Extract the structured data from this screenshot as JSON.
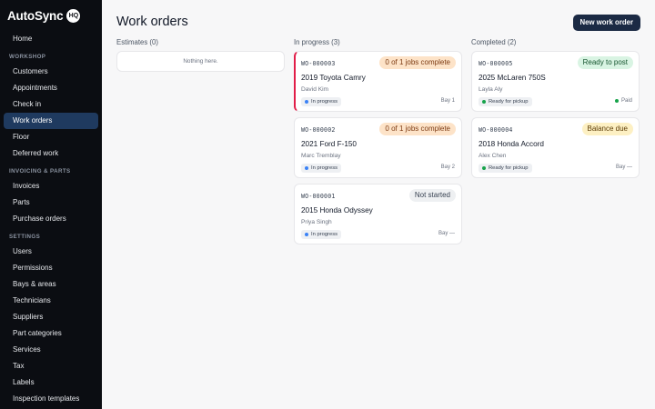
{
  "brand": {
    "name": "AutoSync",
    "badge": "HQ"
  },
  "sidebar": {
    "home": "Home",
    "workshop_title": "WORKSHOP",
    "workshop": [
      "Customers",
      "Appointments",
      "Check in",
      "Work orders",
      "Floor",
      "Deferred work"
    ],
    "invoicing_title": "INVOICING & PARTS",
    "invoicing": [
      "Invoices",
      "Parts",
      "Purchase orders"
    ],
    "settings_title": "SETTINGS",
    "settings": [
      "Users",
      "Permissions",
      "Bays & areas",
      "Technicians",
      "Suppliers",
      "Part categories",
      "Services",
      "Tax",
      "Labels",
      "Inspection templates"
    ]
  },
  "header": {
    "title": "Work orders",
    "new_button": "New work order"
  },
  "columns": {
    "estimates": {
      "title": "Estimates (0)",
      "empty": "Nothing here."
    },
    "in_progress": {
      "title": "In progress (3)",
      "cards": [
        {
          "number": "WO-000003",
          "status": "0 of 1 jobs complete",
          "vehicle": "2019 Toyota Camry",
          "customer": "David Kim",
          "tag": "In progress",
          "right": "Bay 1"
        },
        {
          "number": "WO-000002",
          "status": "0 of 1 jobs complete",
          "vehicle": "2021 Ford F-150",
          "customer": "Marc Tremblay",
          "tag": "In progress",
          "right": "Bay 2"
        },
        {
          "number": "WO-000001",
          "status": "Not started",
          "vehicle": "2015 Honda Odyssey",
          "customer": "Priya Singh",
          "tag": "In progress",
          "right": "Bay —"
        }
      ]
    },
    "completed": {
      "title": "Completed (2)",
      "cards": [
        {
          "number": "WO-000005",
          "status": "Ready to post",
          "vehicle": "2025 McLaren 750S",
          "customer": "Layla Aly",
          "tag": "Ready for pickup",
          "right": "Paid"
        },
        {
          "number": "WO-000004",
          "status": "Balance due",
          "vehicle": "2018 Honda Accord",
          "customer": "Alex Chen",
          "tag": "Ready for pickup",
          "right": "Bay —"
        }
      ]
    }
  },
  "colors": {
    "sidebar_bg": "#0b0d12",
    "active_nav": "#1f3a5f",
    "primary_button": "#1b2a44",
    "urgent_border": "#e11d48"
  },
  "icons": {
    "in_progress_dot": "blue-dot-icon",
    "ready_dot": "green-dot-icon",
    "paid_dot": "green-dot-icon"
  }
}
